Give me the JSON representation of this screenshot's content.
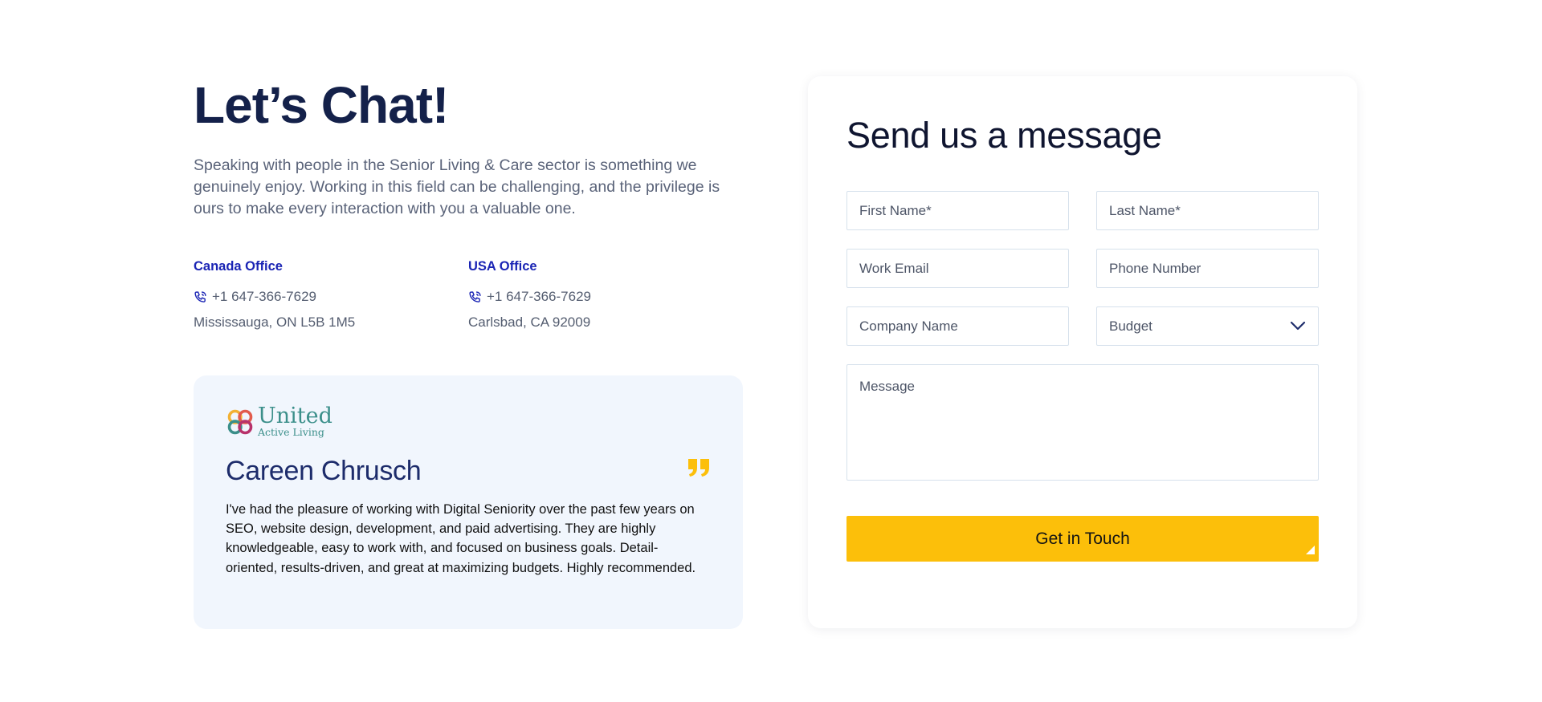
{
  "hero": {
    "title": "Let’s Chat!",
    "text": "Speaking with people in the Senior Living & Care sector is something we genuinely enjoy. Working in this field can be challenging, and the privilege is ours to make every interaction with you a valuable one."
  },
  "offices": [
    {
      "name": "Canada Office",
      "phone": "+1 647-366-7629",
      "address": "Mississauga, ON L5B 1M5"
    },
    {
      "name": "USA Office",
      "phone": "+1 647-366-7629",
      "address": "Carlsbad, CA 92009"
    }
  ],
  "testimonial": {
    "logo_main": "United",
    "logo_sub": "Active Living",
    "name": "Careen Chrusch",
    "quote": "I've had the pleasure of working with Digital Seniority over the past few years on SEO, website design, development, and paid advertising. They are highly knowledgeable, easy to work with, and focused on business goals. Detail-oriented, results-driven, and great at maximizing budgets. Highly recommended."
  },
  "form": {
    "title": "Send us a message",
    "first_name": "First Name*",
    "last_name": "Last Name*",
    "work_email": "Work Email",
    "phone": "Phone Number",
    "company": "Company Name",
    "budget": "Budget",
    "message": "Message",
    "submit": "Get in Touch"
  },
  "icons": {
    "phone": "phone-icon",
    "quote": "quote-icon",
    "chevron": "chevron-down-icon",
    "logo": "united-logo-icon"
  },
  "colors": {
    "accent_yellow": "#fcbf0a",
    "office_blue": "#1a24b4",
    "heading_navy": "#14214a",
    "card_bg": "#f1f6fd"
  }
}
